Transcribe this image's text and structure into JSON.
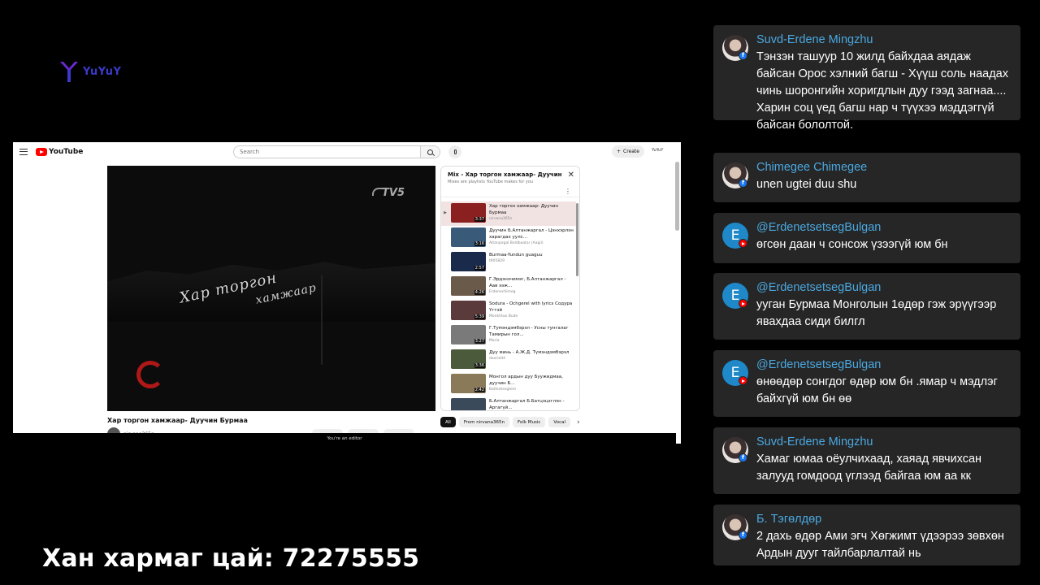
{
  "logo": {
    "text": "YuYuY"
  },
  "caption": "Хан хармаг цай: 72275555",
  "youtube": {
    "brand": "YouTube",
    "search_placeholder": "Search",
    "create_label": "Create",
    "account_label": "YuYuY",
    "video_title": "Хар торгон хамжаар- Дуучин Бурмаа",
    "channel_name": "nirvana365n",
    "editor_notice": "You're an editor",
    "player_overlay": {
      "station": "TV5",
      "title_line1": "Хар торгон",
      "title_line2": "хамжаар",
      "corner_logo": "E"
    },
    "mix": {
      "title": "Mix - Хар торгон хамжаар- Дуучин Бурмаа",
      "subtitle": "Mixes are playlists YouTube makes for you",
      "items": [
        {
          "title": "Хар торгон хамжаар- Дуучин Бурмаа",
          "channel": "nirvana365n",
          "duration": "3:37",
          "active": true,
          "color": "#8a2020"
        },
        {
          "title": "Дуучин Б.Алтанжаргал - Цэнхэрлэн харагдах уулс...",
          "channel": "Altanjargal Boldbaatar (Aagii)",
          "duration": "3:16",
          "active": false,
          "color": "#3a5a7a"
        },
        {
          "title": "Burmaa-Yundun guaguu",
          "channel": "t905829",
          "duration": "2:57",
          "active": false,
          "color": "#1a2a4a"
        },
        {
          "title": "Г.Эрдэнэчимэг, Б.Алтанжаргал - Аав ээж...",
          "channel": "Erdenechimeg",
          "duration": "4:26",
          "active": false,
          "color": "#6a5a4a"
        },
        {
          "title": "Sodura - Ochgerel with lyrics Содура Үгтэй",
          "channel": "Monkhtuo Bude",
          "duration": "5:39",
          "active": false,
          "color": "#5a3a3a"
        },
        {
          "title": "Г.Тумэндэмбэрэл - Усны тунгалаг Тамирын гол...",
          "channel": "Maria",
          "duration": "3:27",
          "active": false,
          "color": "#7a7a7a"
        },
        {
          "title": "Дуу минь - А.Ж.Д. Түмэндэмбэрэл",
          "channel": "doorid44",
          "duration": "3:36",
          "active": false,
          "color": "#4a5a3a"
        },
        {
          "title": "Монгол ардын дуу Буужидмаа, дуучин Б...",
          "channel": "Battsetsegtem",
          "duration": "2:42",
          "active": false,
          "color": "#8a7a5a"
        },
        {
          "title": "Б.Алтанжаргал Б.Батцэцэглэн - Аргагүй...",
          "channel": "",
          "duration": "",
          "active": false,
          "color": "#3a4a5a"
        }
      ]
    },
    "chips": [
      "All",
      "From nirvana365n",
      "Folk Music",
      "Vocal"
    ]
  },
  "chat": [
    {
      "name": "Suvd-Erdene Mingzhu",
      "avatar": "photo",
      "source": "facebook",
      "text": "Тэнзэн ташуур 10 жилд байхдаа аядаж байсан Орос хэлний багш - Хүүш соль наадах чинь шоронгийн хоригдлын дуу гээд загнаа.... Харин соц үед багш нар ч түүхээ мэддэггүй байсан бололтой."
    },
    {
      "name": "Chimegee Chimegee",
      "avatar": "photo",
      "source": "facebook",
      "text": "unen ugtei duu shu"
    },
    {
      "name": "@ErdenetsetsegBulgan",
      "avatar": "E",
      "source": "youtube",
      "text": "өгсөн даан ч сонсож үзээгүй юм бн"
    },
    {
      "name": "@ErdenetsetsegBulgan",
      "avatar": "E",
      "source": "youtube",
      "text": "ууган Бурмаа Монголын 1өдөр гэж эрүүгээр явахдаа сиди билгл"
    },
    {
      "name": "@ErdenetsetsegBulgan",
      "avatar": "E",
      "source": "youtube",
      "text": "өнөөдөр сонгдог өдөр юм бн .ямар ч мэдлэг байхгүй юм бн өө"
    },
    {
      "name": "Suvd-Erdene Mingzhu",
      "avatar": "photo",
      "source": "facebook",
      "text": "Хамаг юмаа оёулчихаад, хаяад явчихсан залууд гомдоод үглээд байгаа юм аа кк"
    },
    {
      "name": "Б. Тэгөлдөр",
      "avatar": "photo",
      "source": "facebook",
      "text": "2 дахь өдөр Ами эгч Хөгжимт үдээрээ зөвхөн Ардын дууг тайлбарлалтай нь"
    }
  ],
  "colors": {
    "chat_bg": "#262626",
    "chat_name": "#4aa8e0",
    "yt_red": "#ff0000",
    "fb_blue": "#1877f2"
  }
}
